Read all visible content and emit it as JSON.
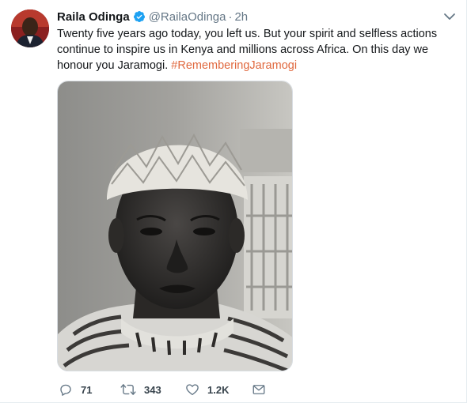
{
  "tweet": {
    "author_name": "Raila Odinga",
    "handle": "@RailaOdinga",
    "separator": "·",
    "time": "2h",
    "text_main": "Twenty five years ago today, you left us. But your spirit and selfless actions continue to inspire us in Kenya and millions across Africa. On this day we honour you Jaramogi. ",
    "hashtag": "#RememberingJaramogi",
    "icons": {
      "verified": "verified-badge-icon",
      "menu": "chevron-down-icon",
      "reply": "reply-icon",
      "retweet": "retweet-icon",
      "like": "heart-icon",
      "dm": "envelope-icon"
    }
  },
  "actions": {
    "reply_count": "71",
    "retweet_count": "343",
    "like_count": "1.2K"
  },
  "colors": {
    "hashtag": "#e0683e",
    "verified": "#1da1f2",
    "muted": "#657786"
  }
}
